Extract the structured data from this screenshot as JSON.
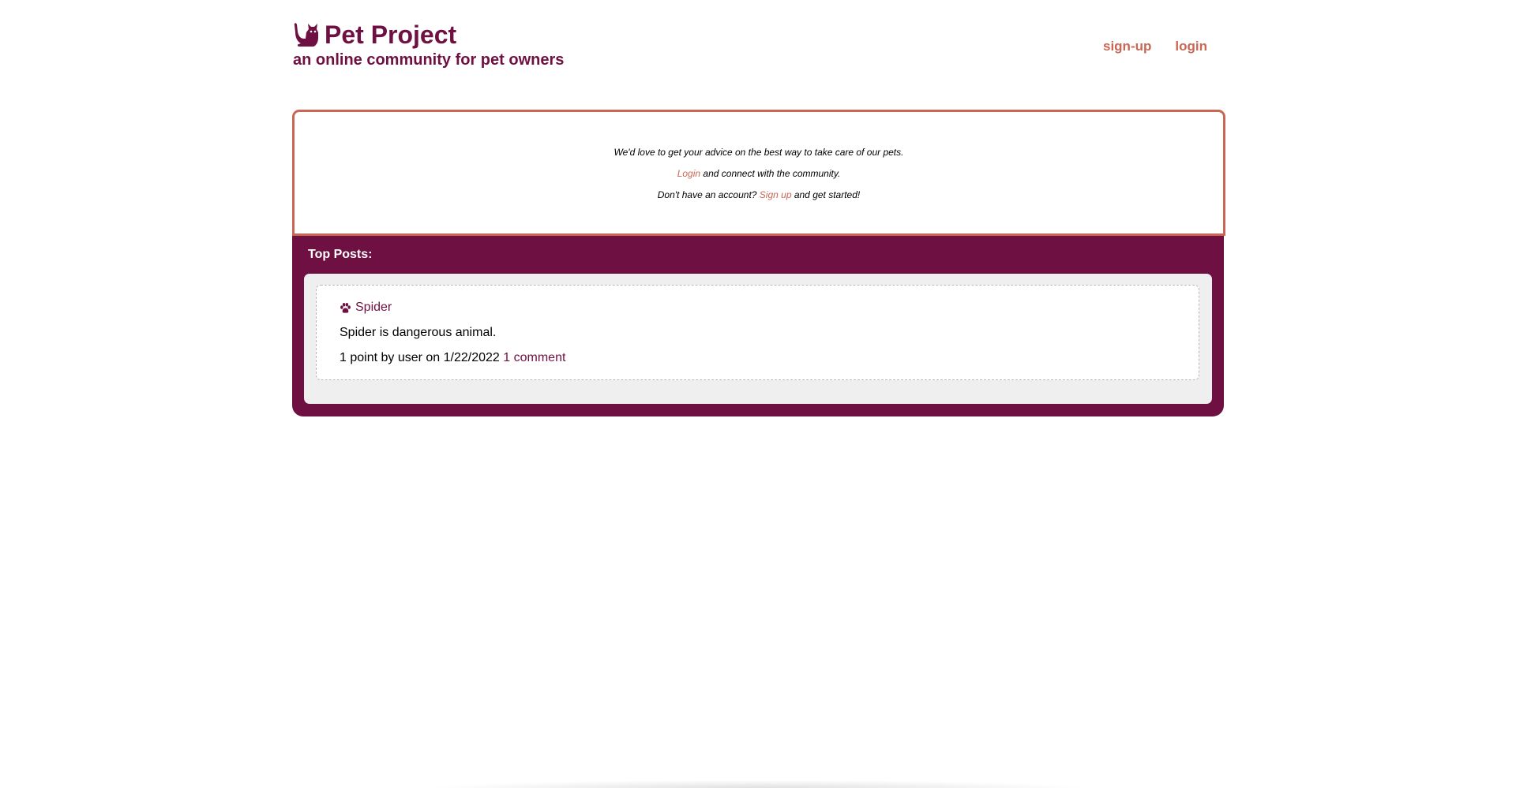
{
  "header": {
    "title": "Pet Project",
    "tagline": "an online community for pet owners",
    "nav": {
      "signup_label": "sign-up",
      "login_label": "login"
    }
  },
  "welcome": {
    "line1": "We'd love to get your advice on the best way to take care of our pets.",
    "line2_link": "Login",
    "line2_rest": " and connect with the community.",
    "line3_before": "Don't have an account? ",
    "line3_link": "Sign up",
    "line3_after": " and get started!"
  },
  "top_posts": {
    "heading": "Top Posts:",
    "posts": [
      {
        "title": "Spider",
        "body": "Spider is dangerous animal.",
        "meta": "1 point by user on 1/22/2022 ",
        "comments_label": "1 comment"
      }
    ]
  },
  "colors": {
    "brand": "#6f1042",
    "accent": "#c96754",
    "panel_bg": "#efefef"
  },
  "icons": {
    "logo": "cat-icon",
    "post": "paw-icon"
  }
}
